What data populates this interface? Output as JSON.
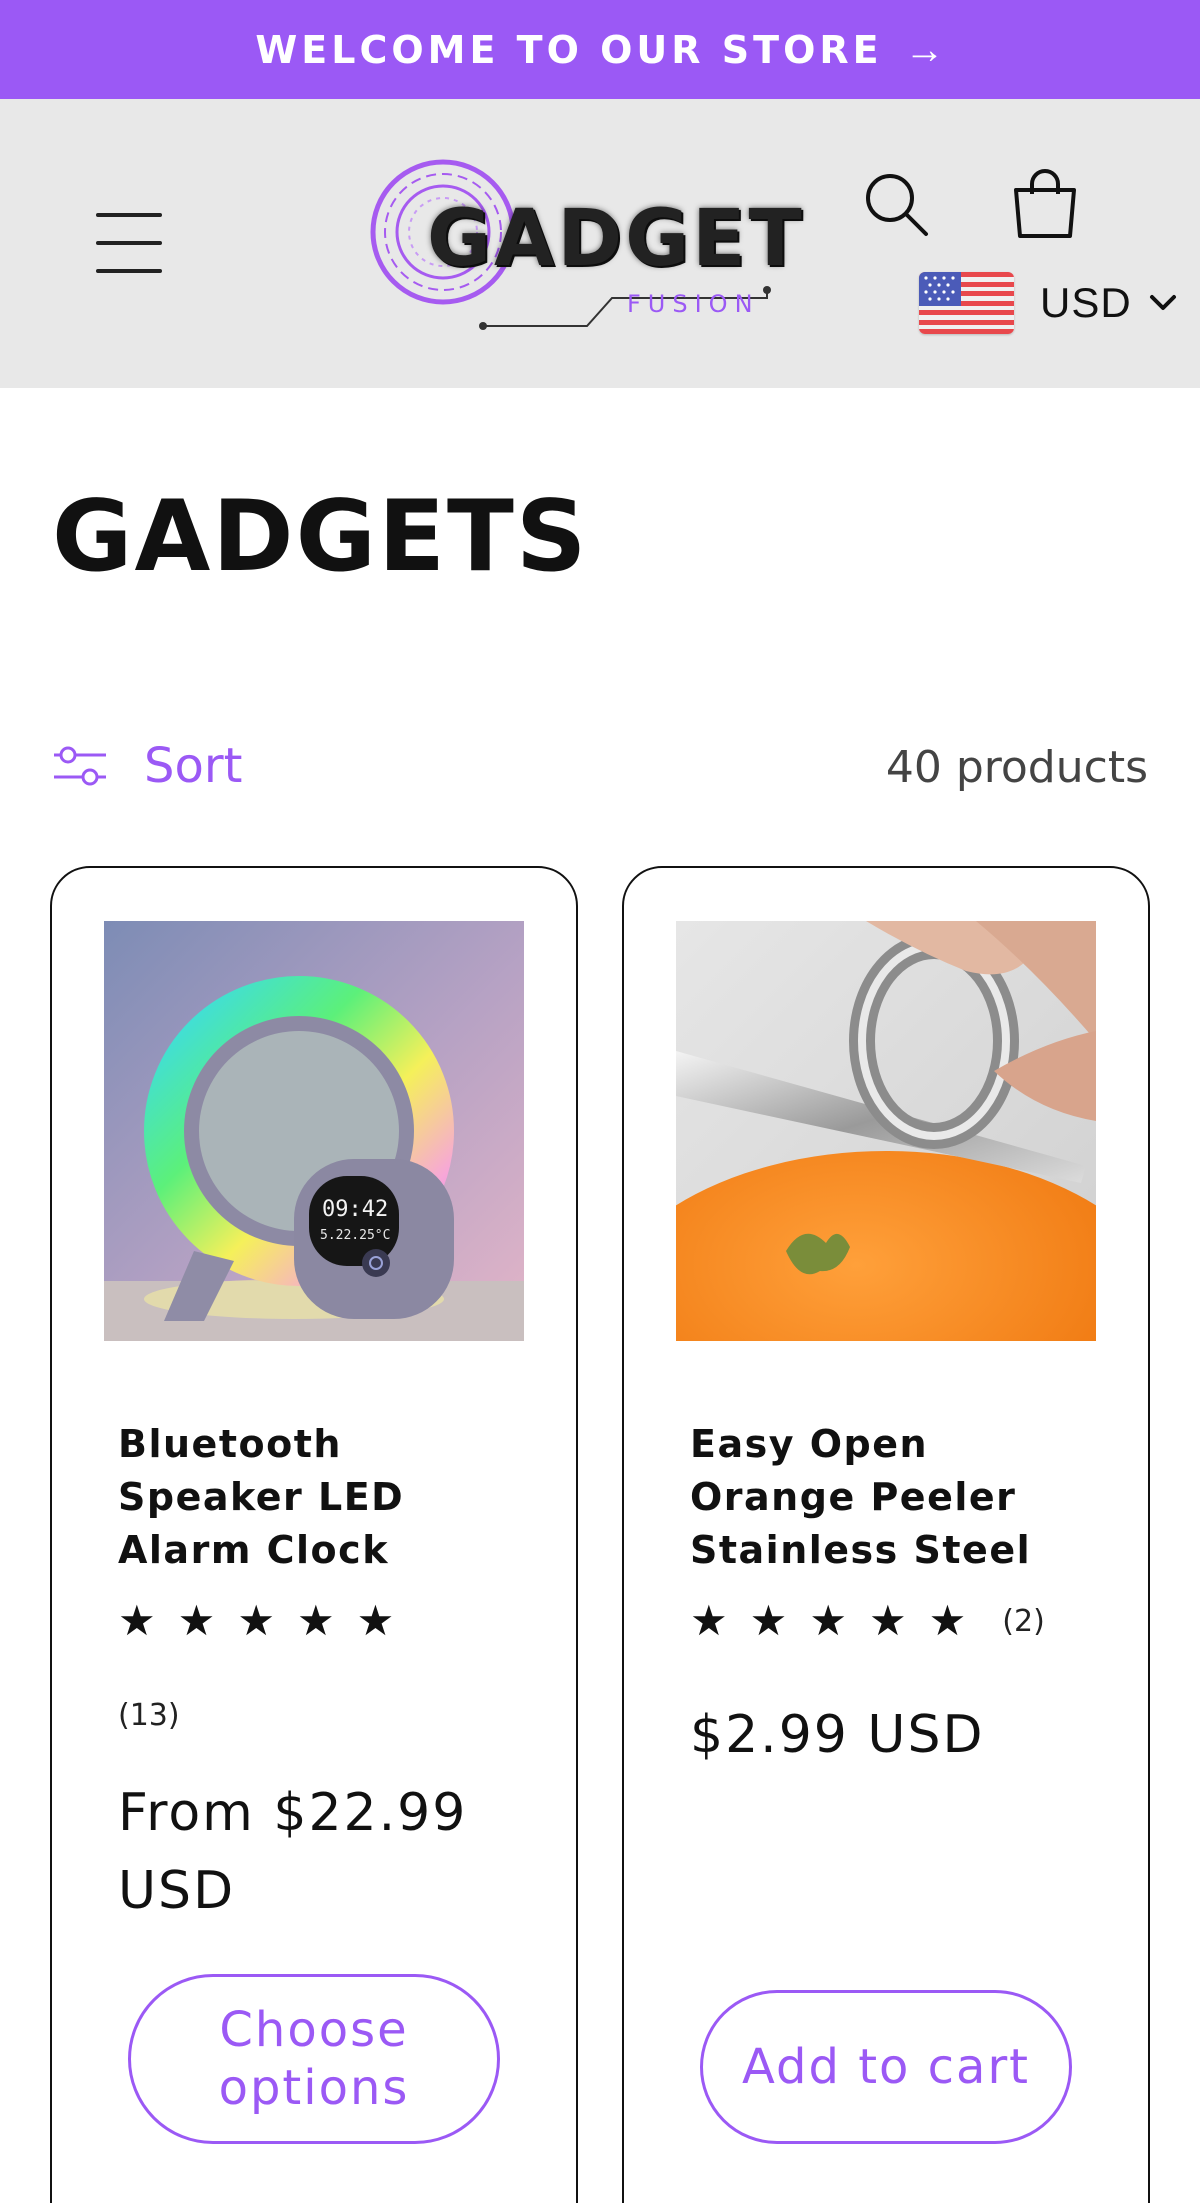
{
  "announcement": {
    "text": "WELCOME TO OUR STORE",
    "arrow": "→"
  },
  "header": {
    "logo": {
      "word": "GADGET",
      "sub": "FUSION"
    },
    "currency": {
      "code": "USD",
      "flag": "us-flag-icon"
    }
  },
  "collection": {
    "title": "GADGETS",
    "sort_label": "Sort",
    "product_count": "40 products"
  },
  "products": [
    {
      "title": "Bluetooth Speaker LED Alarm Clock",
      "stars": "★ ★ ★ ★ ★",
      "rating": 5,
      "reviews": "(13)",
      "price": "From $22.99 USD",
      "action": "Choose options",
      "clock_time": "09:42",
      "clock_sub": "5.22.25°C"
    },
    {
      "title": "Easy Open Orange Peeler Stainless Steel",
      "stars": "★ ★ ★ ★ ★",
      "rating": 5,
      "reviews": "(2)",
      "price": "$2.99 USD",
      "action": "Add to cart"
    }
  ],
  "colors": {
    "accent": "#9b59f5",
    "header_bg": "#e8e8e8",
    "text": "#111111"
  }
}
